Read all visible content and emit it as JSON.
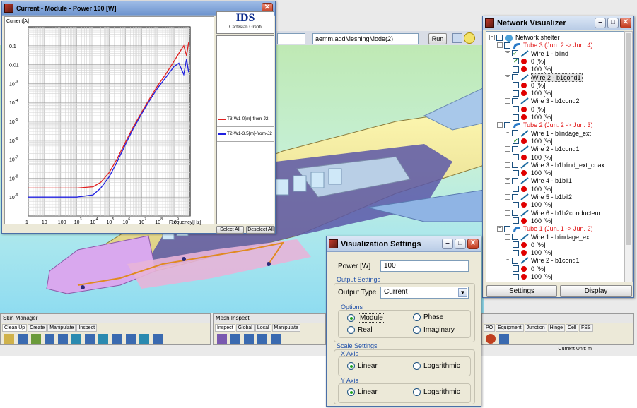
{
  "cad": {
    "toolbar_combo_left": "",
    "toolbar_command": "aemm.addMeshingMode(2)",
    "run_label": "Run",
    "skin_manager": {
      "title": "Skin Manager",
      "tabs": [
        "Clean Up",
        "Create",
        "Manipulate",
        "Inspect"
      ]
    },
    "mesh_inspect": {
      "title": "Mesh Inspect",
      "tabs": [
        "Inspect",
        "Global",
        "Local",
        "Manipulate"
      ]
    },
    "right_tabs": [
      "PO",
      "Equipment",
      "Junction",
      "Hinge",
      "Cell",
      "FSS"
    ],
    "status": "Current Unit: m"
  },
  "chart_window": {
    "title": "Current - Module - Power 100 [W]",
    "logo": "IDS",
    "logo_subtitle": "Cartesian Graph",
    "select_all": "Select All",
    "deselect_all": "Deselect All"
  },
  "chart_data": {
    "type": "line",
    "ylabel": "Current[A]",
    "xlabel": "Frequency[Hz]",
    "x_scale": "log",
    "y_scale": "log",
    "xlim": [
      1,
      10000000000
    ],
    "ylim": [
      1e-10,
      1
    ],
    "x_ticks": [
      "1",
      "10",
      "100",
      "10",
      "10",
      "10",
      "10",
      "10",
      "10",
      "10"
    ],
    "x_tick_exps": [
      "",
      "",
      "",
      "3",
      "4",
      "5",
      "6",
      "7",
      "8",
      "9"
    ],
    "y_ticks": [
      "0.1",
      "0.01",
      "10",
      "10",
      "10",
      "10",
      "10",
      "10",
      "10"
    ],
    "y_tick_exps": [
      "",
      "",
      "-3",
      "-4",
      "-5",
      "-6",
      "-7",
      "-8",
      "-9"
    ],
    "grid": true,
    "series": [
      {
        "name": "T3-W1-0[m]-from-J2",
        "color": "#e02020",
        "x": [
          1,
          10,
          100,
          1000,
          10000,
          30000,
          100000,
          300000,
          1000000,
          3000000,
          10000000,
          30000000,
          100000000,
          300000000,
          1000000000,
          2000000000,
          4000000000,
          6000000000,
          8000000000
        ],
        "y": [
          3e-09,
          3e-09,
          3e-09,
          3e-09,
          3.5e-09,
          6e-09,
          2e-08,
          1e-07,
          8e-07,
          5e-06,
          3e-05,
          0.00015,
          0.0008,
          0.003,
          0.015,
          0.04,
          0.1,
          0.03,
          0.15
        ]
      },
      {
        "name": "T2-W1-3.5[m]-from-J2",
        "color": "#2020e0",
        "x": [
          1,
          10,
          100,
          1000,
          10000,
          30000,
          100000,
          300000,
          1000000,
          3000000,
          10000000,
          30000000,
          100000000,
          300000000,
          1000000000,
          2000000000,
          4000000000,
          6000000000,
          8000000000
        ],
        "y": [
          1e-09,
          1e-09,
          1e-09,
          1e-09,
          1.3e-09,
          3e-09,
          1.2e-08,
          7e-08,
          6e-07,
          4e-06,
          2.5e-05,
          0.00012,
          0.0006,
          0.002,
          0.008,
          0.012,
          0.003,
          0.02,
          0.004
        ]
      }
    ]
  },
  "network": {
    "title": "Network Visualizer",
    "settings_label": "Settings",
    "display_label": "Display",
    "rows": [
      {
        "indent": 0,
        "type": "root",
        "label": "Network shelter",
        "checked": false,
        "expanded": true
      },
      {
        "indent": 1,
        "type": "tube",
        "label": "Tube 3 (Jun. 2 -> Jun. 4)",
        "checked": false,
        "expanded": true
      },
      {
        "indent": 2,
        "type": "wire",
        "label": "Wire 1 - blind",
        "checked": true,
        "expanded": true
      },
      {
        "indent": 3,
        "type": "value",
        "label": "0 [%]",
        "checked": true
      },
      {
        "indent": 3,
        "type": "value",
        "label": "100 [%]",
        "checked": false
      },
      {
        "indent": 2,
        "type": "wire",
        "label": "Wire 2 - b1cond1",
        "checked": false,
        "expanded": true,
        "selected": true
      },
      {
        "indent": 3,
        "type": "value",
        "label": "0 [%]",
        "checked": false
      },
      {
        "indent": 3,
        "type": "value",
        "label": "100 [%]",
        "checked": false
      },
      {
        "indent": 2,
        "type": "wire",
        "label": "Wire 3 - b1cond2",
        "checked": false,
        "expanded": true
      },
      {
        "indent": 3,
        "type": "value",
        "label": "0 [%]",
        "checked": false
      },
      {
        "indent": 3,
        "type": "value",
        "label": "100 [%]",
        "checked": false
      },
      {
        "indent": 1,
        "type": "tube",
        "label": "Tube 2 (Jun. 2 -> Jun. 3)",
        "checked": false,
        "expanded": true
      },
      {
        "indent": 2,
        "type": "wire",
        "label": "Wire 1 - blindage_ext",
        "checked": false,
        "expanded": true
      },
      {
        "indent": 3,
        "type": "value",
        "label": "100 [%]",
        "checked": true
      },
      {
        "indent": 2,
        "type": "wire",
        "label": "Wire 2 - b1cond1",
        "checked": false,
        "expanded": true
      },
      {
        "indent": 3,
        "type": "value",
        "label": "100 [%]",
        "checked": false
      },
      {
        "indent": 2,
        "type": "wire",
        "label": "Wire 3 - b1blind_ext_coax",
        "checked": false,
        "expanded": true
      },
      {
        "indent": 3,
        "type": "value",
        "label": "100 [%]",
        "checked": false
      },
      {
        "indent": 2,
        "type": "wire",
        "label": "Wire 4 - b1bil1",
        "checked": false,
        "expanded": true
      },
      {
        "indent": 3,
        "type": "value",
        "label": "100 [%]",
        "checked": false
      },
      {
        "indent": 2,
        "type": "wire",
        "label": "Wire 5 - b1bil2",
        "checked": false,
        "expanded": true
      },
      {
        "indent": 3,
        "type": "value",
        "label": "100 [%]",
        "checked": false
      },
      {
        "indent": 2,
        "type": "wire",
        "label": "Wire 6 - b1b2conducteur",
        "checked": false,
        "expanded": true
      },
      {
        "indent": 3,
        "type": "value",
        "label": "100 [%]",
        "checked": false
      },
      {
        "indent": 1,
        "type": "tube",
        "label": "Tube 1 (Jun. 1 -> Jun. 2)",
        "checked": false,
        "expanded": true
      },
      {
        "indent": 2,
        "type": "wire",
        "label": "Wire 1 - blindage_ext",
        "checked": false,
        "expanded": true
      },
      {
        "indent": 3,
        "type": "value",
        "label": "0 [%]",
        "checked": false
      },
      {
        "indent": 3,
        "type": "value",
        "label": "100 [%]",
        "checked": false
      },
      {
        "indent": 2,
        "type": "wire",
        "label": "Wire 2 - b1cond1",
        "checked": false,
        "expanded": true
      },
      {
        "indent": 3,
        "type": "value",
        "label": "0 [%]",
        "checked": false
      },
      {
        "indent": 3,
        "type": "value",
        "label": "100 [%]",
        "checked": false
      }
    ]
  },
  "vis_settings": {
    "title": "Visualization Settings",
    "power_label": "Power [W]",
    "power_value": "100",
    "output_settings_title": "Output Settings",
    "output_type_label": "Output Type",
    "output_type_value": "Current",
    "options_title": "Options",
    "module_label": "Module",
    "phase_label": "Phase",
    "real_label": "Real",
    "imaginary_label": "Imaginary",
    "scale_settings_title": "Scale Settings",
    "x_axis_title": "X Axis",
    "y_axis_title": "Y Axis",
    "linear_label": "Linear",
    "log_label": "Logarithmic"
  }
}
